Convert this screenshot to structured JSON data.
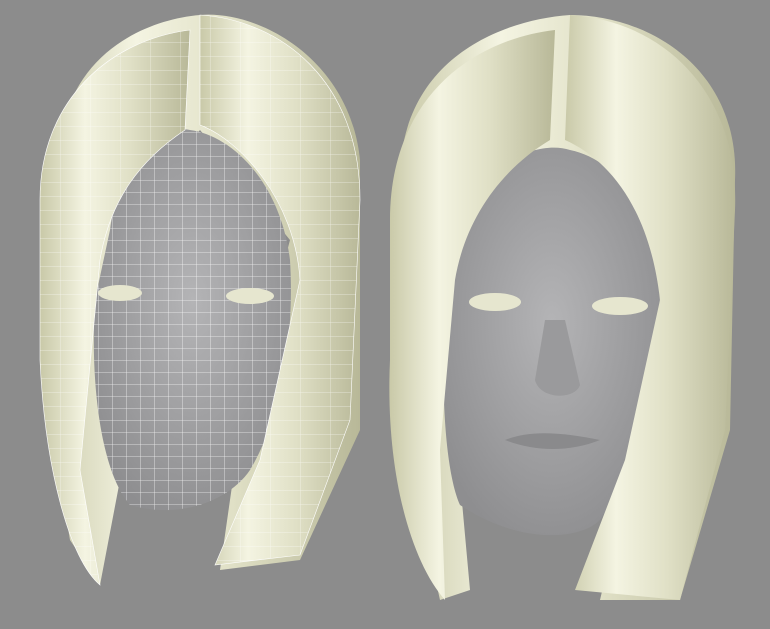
{
  "scene": {
    "background_color": "#8c8c8c",
    "hair_color": "#e6e6cf",
    "skin_color": "#a3a3a5",
    "wire_color": "#ffffff",
    "models": [
      {
        "name": "wireframe-head",
        "wireframe": true
      },
      {
        "name": "shaded-head",
        "wireframe": false
      }
    ]
  }
}
